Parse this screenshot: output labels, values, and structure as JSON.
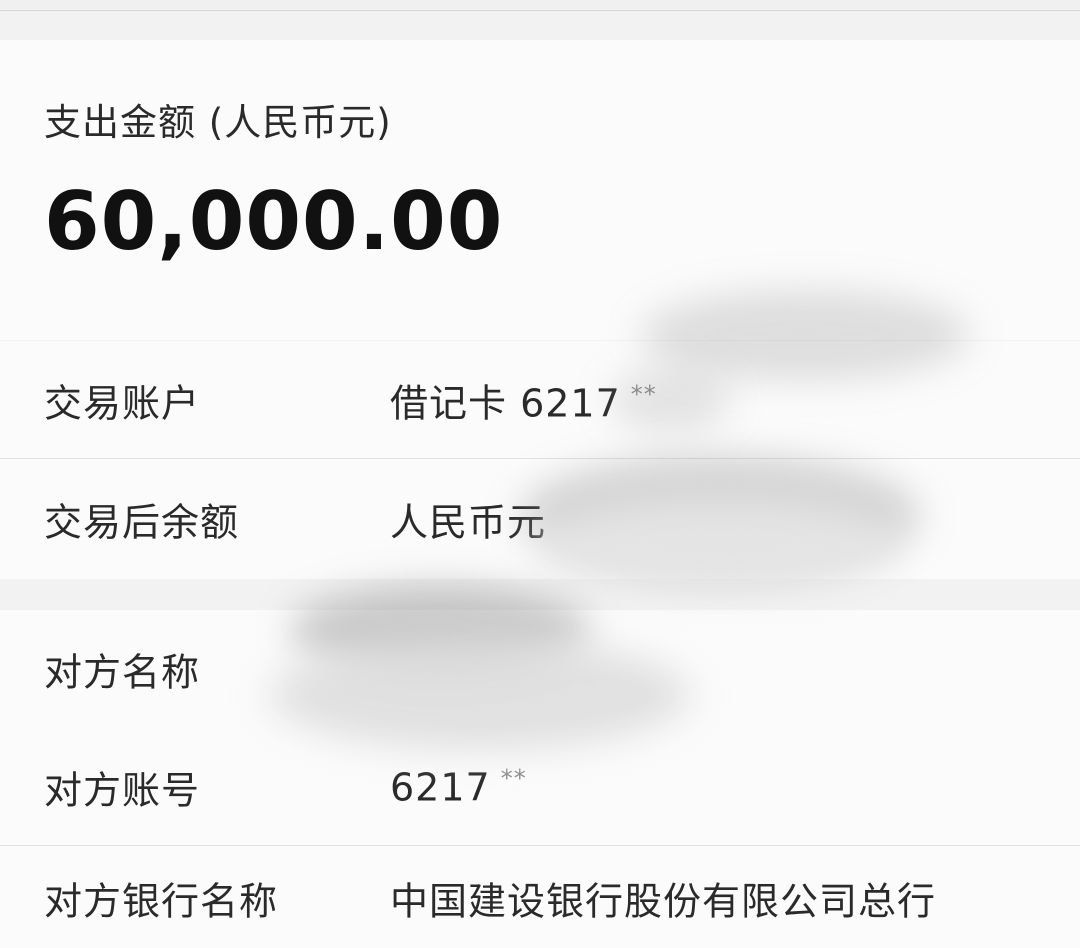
{
  "amount": {
    "label": "支出金额 (人民币元)",
    "value": "60,000.00"
  },
  "account_section": {
    "rows": [
      {
        "label": "交易账户",
        "value": "借记卡 6217",
        "mask": "**"
      },
      {
        "label": "交易后余额",
        "value": "人民币元"
      }
    ]
  },
  "counterparty_section": {
    "rows": [
      {
        "label": "对方名称",
        "value": ""
      },
      {
        "label": "对方账号",
        "value": "6217",
        "mask": "**"
      },
      {
        "label": "对方银行名称",
        "value": "中国建设银行股份有限公司总行"
      }
    ]
  },
  "colors": {
    "background": "#f2f2f2",
    "card": "#fbfbfb",
    "text": "#2a2a2a",
    "amount_text": "#111111",
    "divider": "#e2e2e2"
  }
}
